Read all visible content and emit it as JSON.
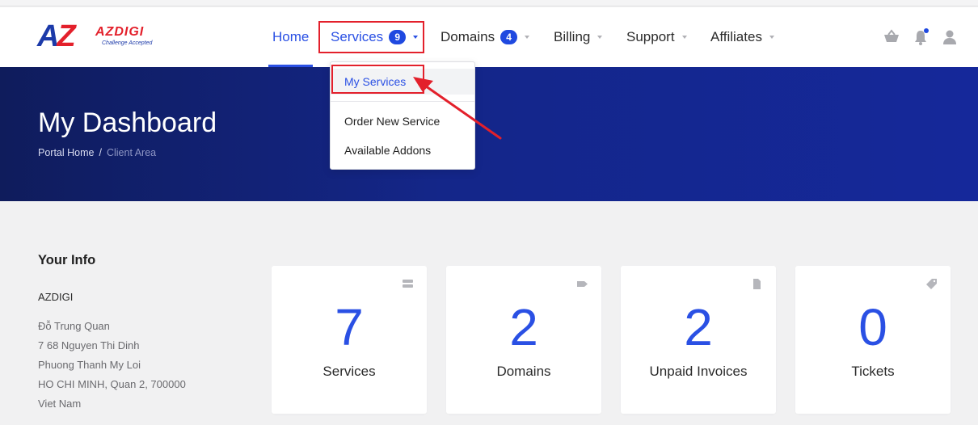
{
  "brand": {
    "mark": "AZ",
    "name": "AZDIGI",
    "tagline": "Challenge Accepted"
  },
  "nav": {
    "home": "Home",
    "services": "Services",
    "services_badge": "9",
    "domains": "Domains",
    "domains_badge": "4",
    "billing": "Billing",
    "support": "Support",
    "affiliates": "Affiliates"
  },
  "header_icons": [
    "cart-icon",
    "bell-icon",
    "user-icon"
  ],
  "services_menu": {
    "items": [
      "My Services",
      "Order New Service",
      "Available Addons"
    ]
  },
  "hero": {
    "title": "My Dashboard",
    "breadcrumb": {
      "home": "Portal Home",
      "separator": "/",
      "current": "Client Area"
    }
  },
  "your_info": {
    "title": "Your Info",
    "company": "AZDIGI",
    "lines": [
      "Đỗ Trung Quan",
      "7 68 Nguyen Thi Dinh",
      "Phuong Thanh My Loi",
      "HO CHI MINH, Quan 2, 700000",
      "Viet Nam"
    ]
  },
  "stats": [
    {
      "value": "7",
      "label": "Services",
      "icon": "server-icon"
    },
    {
      "value": "2",
      "label": "Domains",
      "icon": "tag-icon"
    },
    {
      "value": "2",
      "label": "Unpaid Invoices",
      "icon": "document-icon"
    },
    {
      "value": "0",
      "label": "Tickets",
      "icon": "ticket-icon"
    }
  ],
  "colors": {
    "accent": "#2a50e4",
    "highlight": "#e3202b",
    "hero": "#142689",
    "background": "#f1f1f2"
  }
}
